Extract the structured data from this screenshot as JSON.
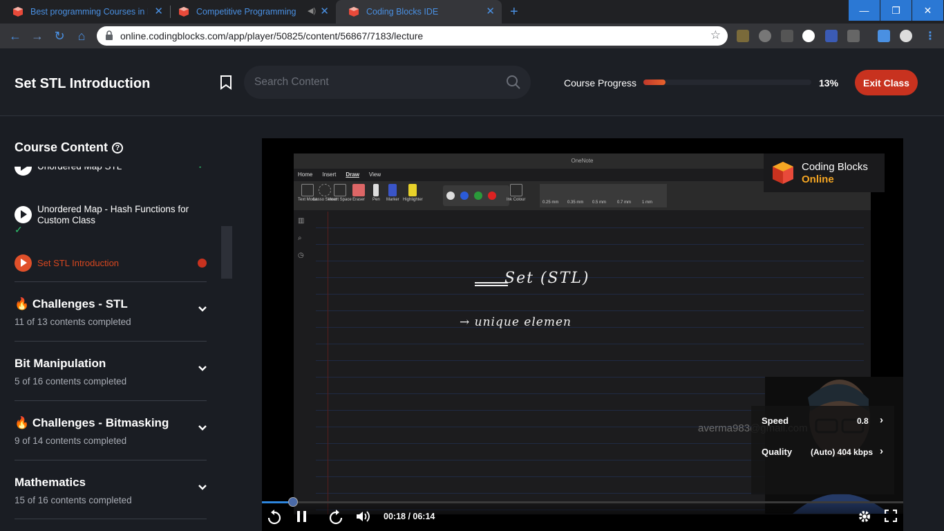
{
  "browser": {
    "tabs": [
      {
        "title": "Best programming Courses in De"
      },
      {
        "title": "Competitive Programming |"
      },
      {
        "title": "Coding Blocks IDE"
      }
    ],
    "url": "online.codingblocks.com/app/player/50825/content/56867/7183/lecture"
  },
  "header": {
    "title": "Set STL Introduction",
    "search_placeholder": "Search Content",
    "progress_label": "Course Progress",
    "progress_value": 13,
    "progress_text": "13%",
    "exit_label": "Exit Class"
  },
  "sidebar": {
    "title": "Course Content",
    "lessons": [
      {
        "title": "Unordered Map STL"
      },
      {
        "title": "Unordered Map - Hash Functions for Custom Class"
      },
      {
        "title": "Set STL Introduction"
      }
    ],
    "sections": [
      {
        "name": "🔥 Challenges - STL",
        "count": "11 of 13 contents completed"
      },
      {
        "name": "Bit Manipulation",
        "count": "5 of 16 contents completed"
      },
      {
        "name": "🔥 Challenges - Bitmasking",
        "count": "9 of 14 contents completed"
      },
      {
        "name": "Mathematics",
        "count": "15 of 16 contents completed"
      }
    ]
  },
  "video": {
    "app_title": "OneNote",
    "menu": [
      "Home",
      "Insert",
      "Draw",
      "View"
    ],
    "ribbon": [
      "Text Mode",
      "Lasso Select",
      "Insert Space",
      "Eraser",
      "Pen",
      "Marker",
      "Highlighter",
      "Ink Colour",
      "0.25 mm",
      "0.35 mm",
      "0.5 mm",
      "0.7 mm",
      "1 mm"
    ],
    "logo_line1": "Coding Blocks",
    "logo_line2": "Online",
    "handwriting_1": "Set (STL)",
    "handwriting_2": "→ unique elemen",
    "watermark": "averma983@gmail.com",
    "settings": {
      "speed_label": "Speed",
      "speed_value": "0.8",
      "quality_label": "Quality",
      "quality_value": "(Auto) 404 kbps"
    },
    "time_text": "00:18 / 06:14",
    "played_fraction": 0.049
  },
  "colors": {
    "accent": "#c8321f",
    "link": "#4a90e2",
    "bg": "#1a1d23"
  }
}
